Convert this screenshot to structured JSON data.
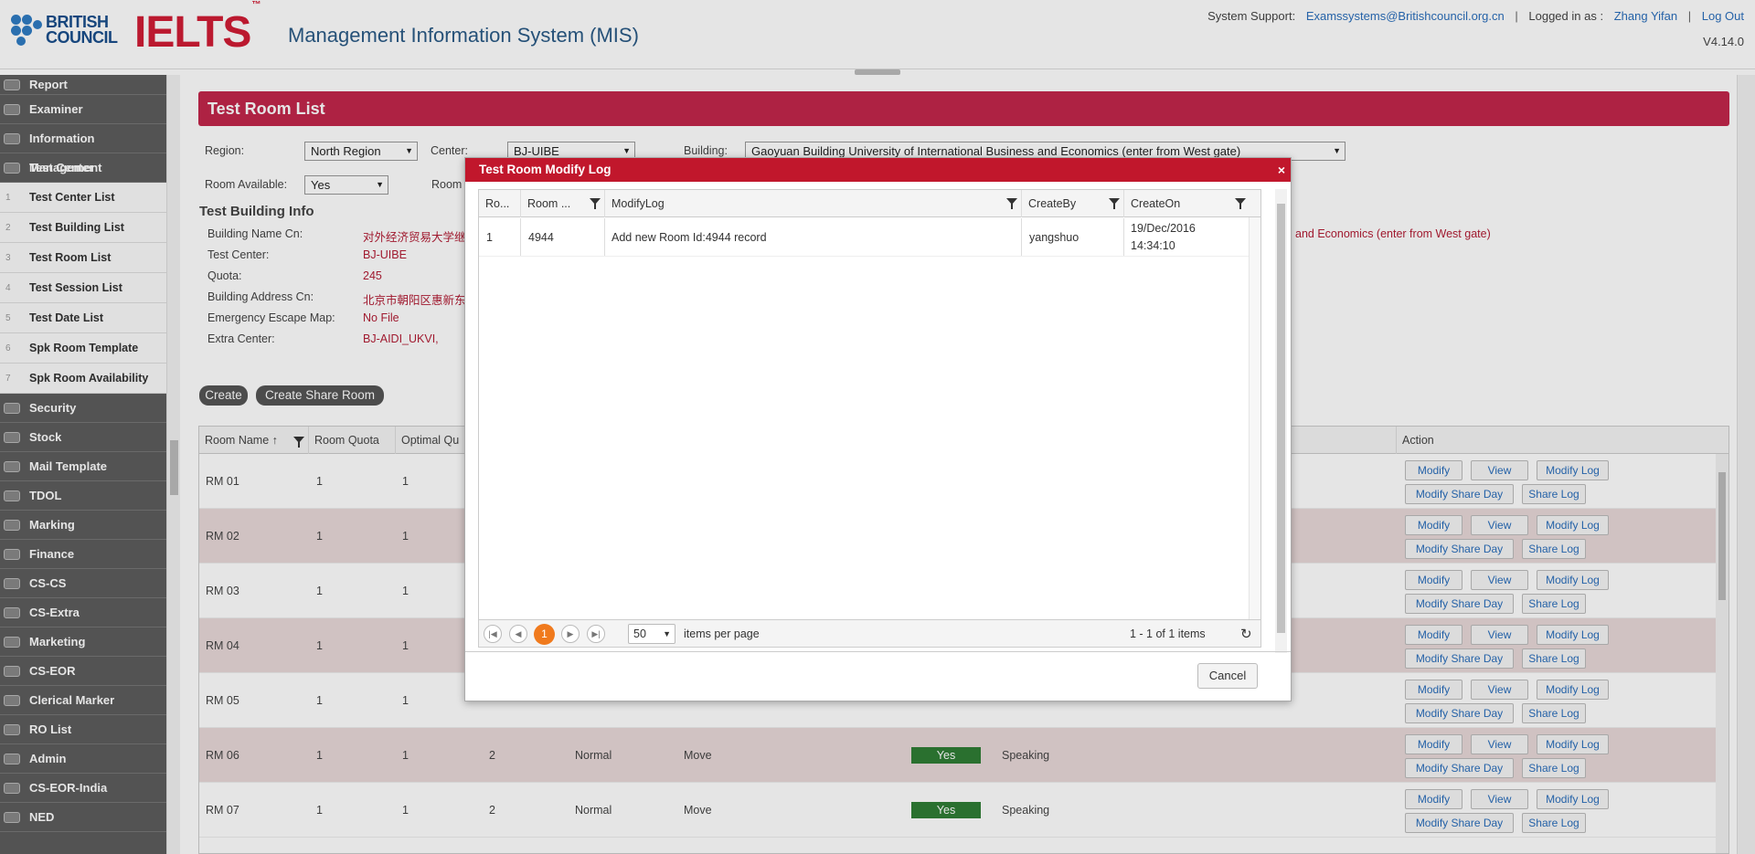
{
  "header": {
    "brand1": "BRITISH",
    "brand2": "COUNCIL",
    "ielts": "IELTS",
    "ielts_mark": "™",
    "app_title": "Management Information System (MIS)",
    "support_label": "System Support:",
    "support_email": "Examssystems@Britishcouncil.org.cn",
    "logged_label": "Logged in as :",
    "user": "Zhang Yifan",
    "logout": "Log Out",
    "version": "V4.14.0",
    "sep": "|"
  },
  "sidebar": {
    "top": [
      "Report",
      "Examiner",
      "Information Management",
      "Test Center"
    ],
    "sub": [
      {
        "num": "1",
        "label": "Test Center List"
      },
      {
        "num": "2",
        "label": "Test Building List"
      },
      {
        "num": "3",
        "label": "Test Room List"
      },
      {
        "num": "4",
        "label": "Test Session List"
      },
      {
        "num": "5",
        "label": "Test Date List"
      },
      {
        "num": "6",
        "label": "Spk Room Template"
      },
      {
        "num": "7",
        "label": "Spk Room Availability"
      }
    ],
    "bottom": [
      "Security",
      "Stock",
      "Mail Template",
      "TDOL",
      "Marking",
      "Finance",
      "CS-CS",
      "CS-Extra",
      "Marketing",
      "CS-EOR",
      "Clerical Marker",
      "RO List",
      "Admin",
      "CS-EOR-India",
      "NED"
    ]
  },
  "page": {
    "title": "Test Room List",
    "region_label": "Region:",
    "region_value": "North Region",
    "center_label": "Center:",
    "center_value": "BJ-UIBE",
    "building_label": "Building:",
    "building_value": "Gaoyuan Building University of International Business and Economics (enter from West gate)",
    "room_available_label": "Room Available:",
    "room_available_value": "Yes",
    "room_label": "Room",
    "info_title": "Test Building Info",
    "info": [
      {
        "label": "Building Name Cn:",
        "value": "对外经济贸易大学继续"
      },
      {
        "label": "Test Center:",
        "value": "BJ-UIBE"
      },
      {
        "label": "Quota:",
        "value": "245"
      },
      {
        "label": "Building Address Cn:",
        "value": "北京市朝阳区惠新东街"
      },
      {
        "label": "Emergency Escape Map:",
        "value": "No File"
      },
      {
        "label": "Extra Center:",
        "value": "BJ-AIDI_UKVI,"
      }
    ],
    "building_en_tail": "and Economics (enter from West gate)",
    "create": "Create",
    "create_share": "Create Share Room"
  },
  "grid": {
    "headers": [
      "Room Name ↑",
      "Room Quota",
      "Optimal Qu",
      "Action"
    ],
    "rows": [
      {
        "name": "RM 01",
        "quota": "1",
        "opt": "1",
        "c4": "",
        "c5": "",
        "c6": "",
        "yes": "",
        "c8": ""
      },
      {
        "name": "RM 02",
        "quota": "1",
        "opt": "1",
        "c4": "",
        "c5": "",
        "c6": "",
        "yes": "",
        "c8": ""
      },
      {
        "name": "RM 03",
        "quota": "1",
        "opt": "1",
        "c4": "",
        "c5": "",
        "c6": "",
        "yes": "",
        "c8": ""
      },
      {
        "name": "RM 04",
        "quota": "1",
        "opt": "1",
        "c4": "",
        "c5": "",
        "c6": "",
        "yes": "",
        "c8": ""
      },
      {
        "name": "RM 05",
        "quota": "1",
        "opt": "1",
        "c4": "",
        "c5": "",
        "c6": "",
        "yes": "",
        "c8": ""
      },
      {
        "name": "RM 06",
        "quota": "1",
        "opt": "1",
        "c4": "2",
        "c5": "Normal",
        "c6": "Move",
        "yes": "Yes",
        "c8": "Speaking"
      },
      {
        "name": "RM 07",
        "quota": "1",
        "opt": "1",
        "c4": "2",
        "c5": "Normal",
        "c6": "Move",
        "yes": "Yes",
        "c8": "Speaking"
      }
    ],
    "actions": {
      "modify": "Modify",
      "view": "View",
      "modify_log": "Modify Log",
      "modify_share": "Modify Share Day",
      "share_log": "Share Log"
    }
  },
  "modal": {
    "title": "Test Room Modify Log",
    "close": "×",
    "headers": [
      "Ro...",
      "Room ...",
      "ModifyLog",
      "CreateBy",
      "CreateOn"
    ],
    "row": {
      "ro": "1",
      "room": "4944",
      "log": "Add new Room Id:4944 record",
      "by": "yangshuo",
      "on_date": "19/Dec/2016",
      "on_time": "14:34:10"
    },
    "page_current": "1",
    "page_size": "50",
    "items_per_page": "items per page",
    "summary": "1 - 1 of 1 items",
    "cancel": "Cancel"
  }
}
